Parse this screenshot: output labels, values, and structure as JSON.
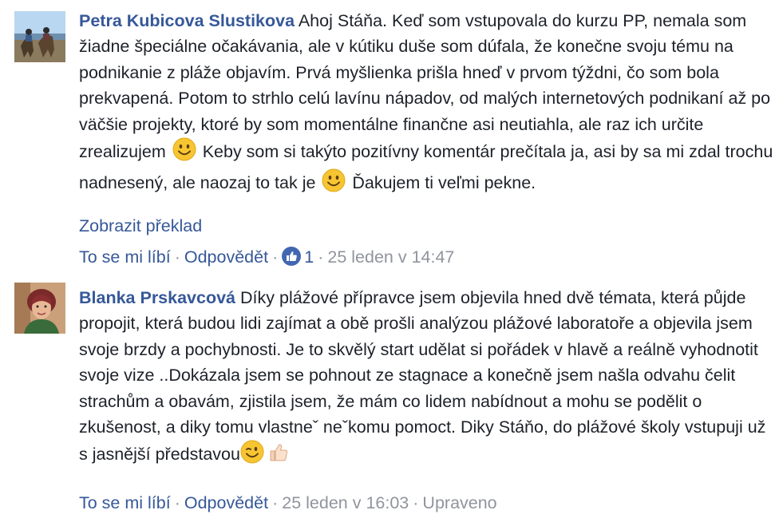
{
  "comments": [
    {
      "author": "Petra Kubicova Slustikova",
      "text_parts": [
        "Ahoj Stáňa. Keď som vstupovala do kurzu PP, nemala som žiadne špeciálne očakávania, ale v kútiku duše som dúfala, že konečne svoju tému na podnikanie z pláže objavím. Prvá myšlienka prišla hneď v prvom týždni, čo som bola prekvapená. Potom to strhlo celú lavínu nápadov, od malých internetových podnikaní až po väčšie projekty, ktoré by som momentálne finančne asi neutiahla, ale raz ich určite zrealizujem",
        "Keby som si takýto pozitívny komentár prečítala ja, asi by sa mi zdal trochu nadnesený, ale naozaj to tak je",
        "Ďakujem ti veľmi pekne."
      ],
      "translate_link": "Zobrazit překlad",
      "like_label": "To se mi líbí",
      "reply_label": "Odpovědět",
      "like_count": "1",
      "timestamp": "25 leden v 14:47"
    },
    {
      "author": "Blanka Prskavcová",
      "text_parts": [
        "Díky plážové přípravce jsem objevila hned dvě témata, která půjde propojit, která budou lidi zajímat a obě prošli analýzou plážové laboratoře a objevila jsem svoje brzdy a pochybnosti. Je to skvělý start udělat si pořádek v hlavě a reálně vyhodnotit svoje vize ..Dokázala jsem se pohnout ze stagnace a konečně jsem našla odvahu čelit strachům a obavám, zjistila jsem, že mám co lidem nabídnout a mohu se podělit o zkušenost, a diky tomu vlastneˇ neˇkomu pomoct. Diky Stáňo, do plážové školy vstupuji už s jasnější představou"
      ],
      "like_label": "To se mi líbí",
      "reply_label": "Odpovědět",
      "timestamp": "25 leden v 16:03",
      "edited_label": "Upraveno"
    }
  ],
  "colors": {
    "link": "#365899",
    "text": "#1d2129",
    "meta": "#90949c",
    "like_blue": "#4267b2",
    "emoji_yellow": "#f7c531"
  },
  "icons": [
    "avatar-beach-horses",
    "avatar-woman",
    "smile-emoji",
    "wink-emoji",
    "thumbs-up-emoji",
    "like-badge-icon"
  ]
}
